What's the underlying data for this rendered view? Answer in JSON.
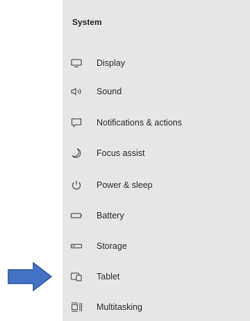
{
  "sidebar": {
    "section_title": "System",
    "items": [
      {
        "label": "Display",
        "icon": "display-icon"
      },
      {
        "label": "Sound",
        "icon": "sound-icon"
      },
      {
        "label": "Notifications & actions",
        "icon": "notifications-icon"
      },
      {
        "label": "Focus assist",
        "icon": "focus-assist-icon"
      },
      {
        "label": "Power & sleep",
        "icon": "power-icon"
      },
      {
        "label": "Battery",
        "icon": "battery-icon"
      },
      {
        "label": "Storage",
        "icon": "storage-icon"
      },
      {
        "label": "Tablet",
        "icon": "tablet-icon"
      },
      {
        "label": "Multitasking",
        "icon": "multitasking-icon"
      }
    ]
  },
  "annotation": {
    "arrow_color": "#4472c4",
    "points_to": "Tablet"
  },
  "colors": {
    "panel_bg": "#e6e6e6",
    "text": "#2a2a2a",
    "icon": "#555555"
  }
}
